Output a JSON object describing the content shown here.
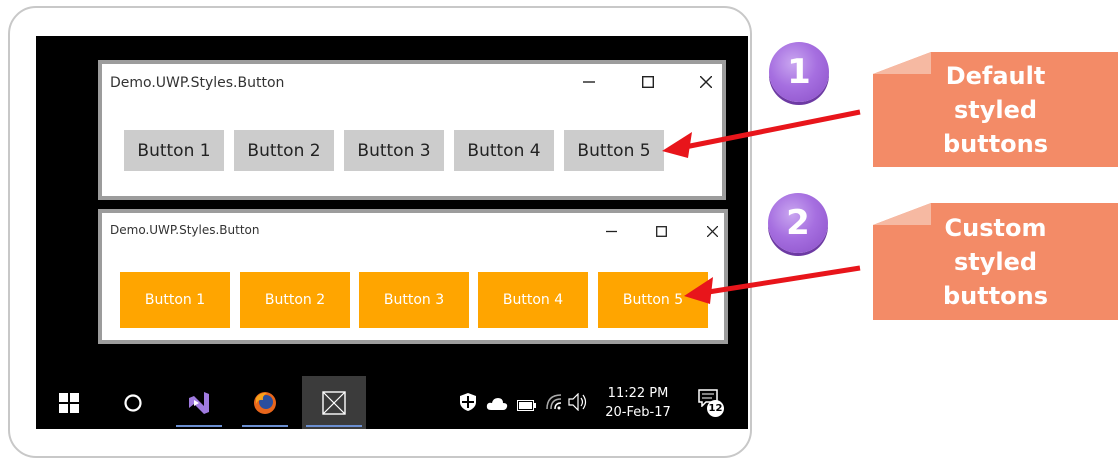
{
  "windows": [
    {
      "title": "Demo.UWP.Styles.Button",
      "buttons": [
        "Button 1",
        "Button 2",
        "Button 3",
        "Button 4",
        "Button 5"
      ]
    },
    {
      "title": "Demo.UWP.Styles.Button",
      "buttons": [
        "Button 1",
        "Button 2",
        "Button 3",
        "Button 4",
        "Button 5"
      ]
    }
  ],
  "window_controls": [
    "minimize-icon",
    "maximize-icon",
    "close-icon"
  ],
  "taskbar": {
    "items": [
      "windows-start-icon",
      "cortana-search-icon",
      "visual-studio-icon",
      "firefox-icon",
      "app-window-icon"
    ],
    "tray": [
      "defender-shield-icon",
      "onedrive-cloud-icon",
      "battery-icon",
      "wifi-icon",
      "volume-icon"
    ],
    "time": "11:22 PM",
    "date": "20-Feb-17",
    "notification_count": "12"
  },
  "annotations": [
    {
      "number": "1",
      "text": "Default styled buttons"
    },
    {
      "number": "2",
      "text": "Custom styled buttons"
    }
  ],
  "colors": {
    "default_button": "#cccccc",
    "custom_button": "#ffa500",
    "callout": "#f38b67",
    "arrow": "#e8151b",
    "badge": "#a66fe0"
  }
}
